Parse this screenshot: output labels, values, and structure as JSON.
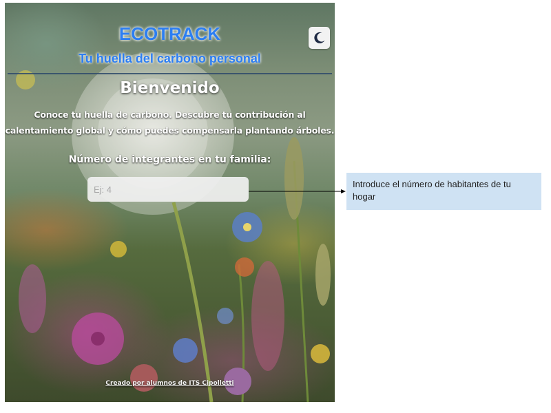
{
  "app": {
    "title": "ECOTRACK",
    "subtitle": "Tu huella del carbono personal",
    "theme_toggle_icon": "moon-icon"
  },
  "main": {
    "welcome": "Bienvenido",
    "intro": "Conoce tu huella de carbono. Descubre tu contribución al calentamiento global y cómo puedes compensarla plantando árboles.",
    "members_label": "Número de integrantes en tu familia:",
    "members_input": {
      "value": "",
      "placeholder": "Ej: 4"
    }
  },
  "footer": {
    "credit": "Creado por alumnos de ITS Cipolletti"
  },
  "annotation": {
    "text": "Introduce el número de habitantes de tu hogar"
  },
  "colors": {
    "brand": "#2c7ef2",
    "callout_bg": "#cfe2f3",
    "divider": "#2f4b6b"
  }
}
